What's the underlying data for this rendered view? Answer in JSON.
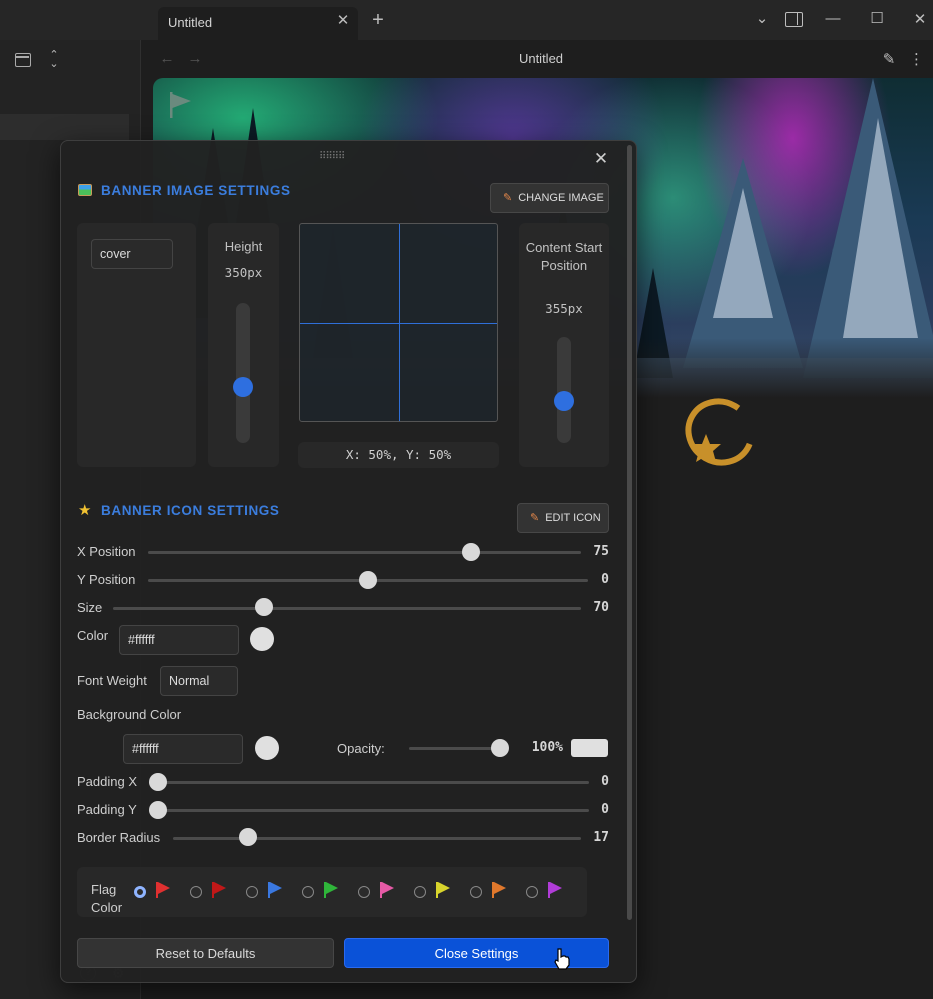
{
  "window": {
    "tab_title": "Untitled",
    "tab_close": "✕",
    "new_tab": "+",
    "chevron": "⌄",
    "minimize": "—",
    "maximize": "☐",
    "close": "✕"
  },
  "note": {
    "title": "Untitled",
    "back": "←",
    "forward": "→",
    "menu": "⋮"
  },
  "modal": {
    "close": "✕",
    "drag_handle": "⠿⠿⠿⠿",
    "banner_image": {
      "title": "BANNER IMAGE SETTINGS",
      "change_image": "CHANGE IMAGE",
      "fit_value": "cover",
      "height_label": "Height",
      "height_value": "350px",
      "height_level": 0.4,
      "position_readout": "X: 50%, Y: 50%",
      "content_start_label": "Content Start Position",
      "content_start_value": "355px",
      "content_start_level": 0.4
    },
    "banner_icon": {
      "title": "BANNER ICON SETTINGS",
      "edit_icon": "EDIT ICON",
      "x_position_label": "X Position",
      "x_position_value": "75",
      "y_position_label": "Y Position",
      "y_position_value": "0",
      "size_label": "Size",
      "size_value": "70",
      "color_label": "Color",
      "color_value": "#ffffff",
      "font_weight_label": "Font Weight",
      "font_weight_value": "Normal",
      "background_color_label": "Background Color",
      "background_color_value": "#ffffff",
      "opacity_label": "Opacity:",
      "opacity_value": "100%",
      "padding_x_label": "Padding X",
      "padding_x_value": "0",
      "padding_y_label": "Padding Y",
      "padding_y_value": "0",
      "border_radius_label": "Border Radius",
      "border_radius_value": "17"
    },
    "flag_color": {
      "label": "Flag Color",
      "options": [
        "#e03030",
        "#c01818",
        "#3a78e0",
        "#2fb53a",
        "#e65aa6",
        "#d8d42c",
        "#e0782c",
        "#b13cd8"
      ],
      "selected_index": 0
    },
    "reset_label": "Reset to Defaults",
    "close_settings_label": "Close Settings"
  },
  "colors": {
    "accent": "#0a52d8",
    "section_title": "#3b7ddd",
    "icon_gold": "#c8902a"
  }
}
